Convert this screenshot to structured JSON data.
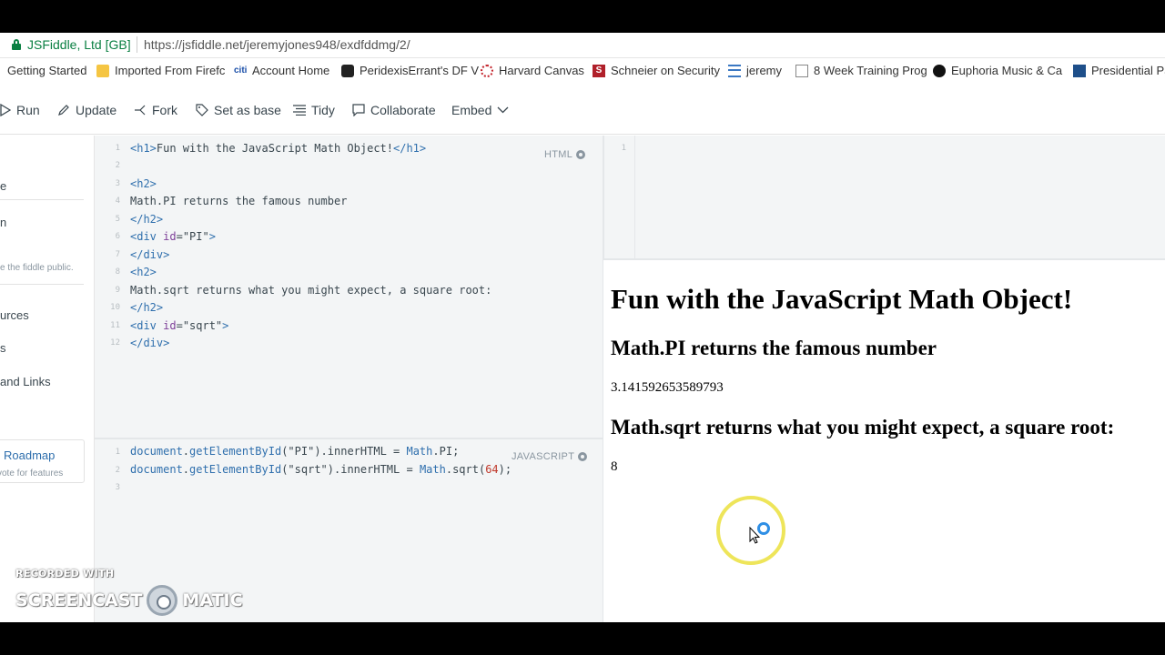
{
  "browser": {
    "site_name": "JSFiddle, Ltd [GB]",
    "url": "https://jsfiddle.net/jeremyjones948/exdfddmg/2/"
  },
  "bookmarks": [
    {
      "label": "Getting Started",
      "icon": "none"
    },
    {
      "label": "Imported From Firefc",
      "icon": "folder-icon"
    },
    {
      "label": "Account Home",
      "icon": "citi-icon"
    },
    {
      "label": "PeridexisErrant's DF V",
      "icon": "peridexis-icon"
    },
    {
      "label": "Harvard Canvas",
      "icon": "canvas-icon"
    },
    {
      "label": "Schneier on Security",
      "icon": "schneier-icon"
    },
    {
      "label": "jeremy",
      "icon": "list-icon"
    },
    {
      "label": "8 Week Training Prog",
      "icon": "document-icon"
    },
    {
      "label": "Euphoria Music & Ca",
      "icon": "euphoria-icon"
    },
    {
      "label": "Presidential Pa",
      "icon": "presidential-icon"
    }
  ],
  "toolbar": {
    "run": "Run",
    "update": "Update",
    "fork": "Fork",
    "set_as_base": "Set as base",
    "tidy": "Tidy",
    "collaborate": "Collaborate",
    "embed": "Embed"
  },
  "sidebar": {
    "item1": "e",
    "item2": "n",
    "item3": "e the fiddle public.",
    "item4": "urces",
    "item5": "s",
    "item6": "and Links",
    "roadmap": "Roadmap",
    "roadmap_sub": "vote for features"
  },
  "html_panel": {
    "label": "HTML",
    "line_numbers": [
      "1",
      "2",
      "3",
      "4",
      "5",
      "6",
      "7",
      "8",
      "9",
      "10",
      "11",
      "12"
    ]
  },
  "js_panel": {
    "label": "JAVASCRIPT",
    "line_numbers": [
      "1",
      "2",
      "3"
    ]
  },
  "css_panel": {
    "line_numbers": [
      "1"
    ]
  },
  "result": {
    "h1": "Fun with the JavaScript Math Object!",
    "h2_pi": "Math.PI returns the famous number",
    "pi_value": "3.141592653589793",
    "h2_sqrt": "Math.sqrt returns what you might expect, a square root:",
    "sqrt_value": "8"
  },
  "watermark": {
    "line1": "RECORDED WITH",
    "line2a": "SCREENCAST",
    "line2b": "MATIC"
  }
}
